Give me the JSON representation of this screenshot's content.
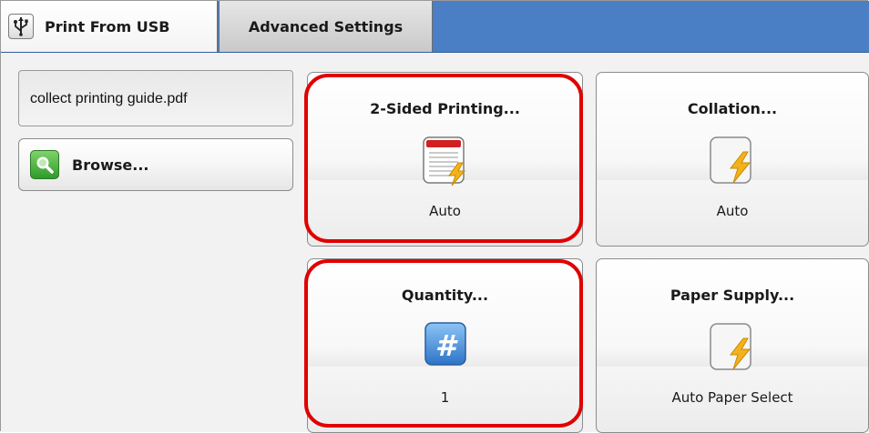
{
  "tabs": {
    "print_from_usb": "Print From USB",
    "advanced_settings": "Advanced Settings"
  },
  "file": {
    "name": "collect printing guide.pdf"
  },
  "browse": {
    "label": "Browse..."
  },
  "cards": [
    {
      "title": "2-Sided Printing...",
      "value": "Auto",
      "icon": "duplex-document-icon",
      "highlighted": true
    },
    {
      "title": "Collation...",
      "value": "Auto",
      "icon": "auto-lightning-icon",
      "highlighted": false
    },
    {
      "title": "Quantity...",
      "value": "1",
      "icon": "number-sign-icon",
      "highlighted": true
    },
    {
      "title": "Paper Supply...",
      "value": "Auto Paper Select",
      "icon": "auto-lightning-icon",
      "highlighted": false
    }
  ],
  "colors": {
    "tabbar_blue": "#4a7fc6",
    "highlight_red": "#e10000",
    "lightning_yellow": "#f3b21c",
    "quantity_blue": "#3f8fe0"
  }
}
